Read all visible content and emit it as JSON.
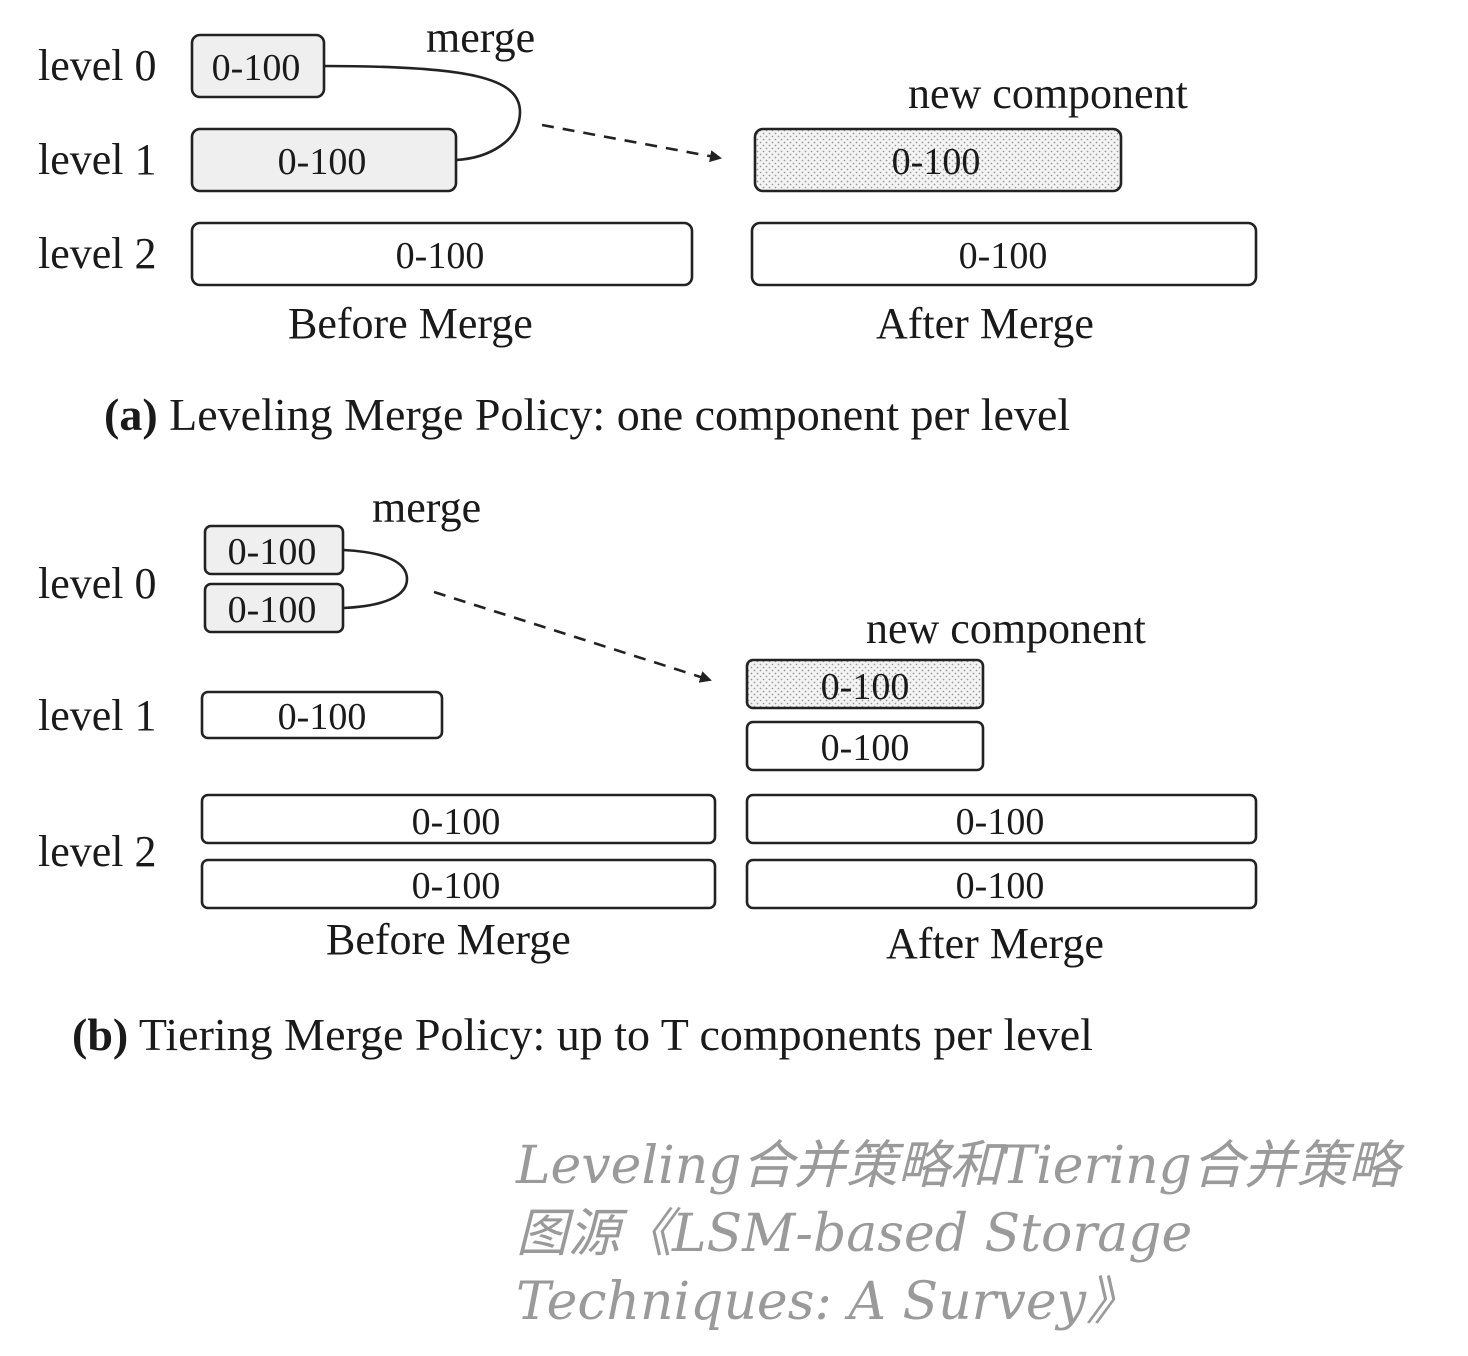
{
  "panel_a": {
    "level_labels": [
      "level 0",
      "level 1",
      "level 2"
    ],
    "merge_label": "merge",
    "new_component_label": "new component",
    "before": {
      "level0": "0-100",
      "level1": "0-100",
      "level2": "0-100",
      "label": "Before Merge"
    },
    "after": {
      "new_component": "0-100",
      "level2": "0-100",
      "label": "After Merge"
    },
    "caption_prefix": "(a)",
    "caption_text": " Leveling Merge Policy: one component per level"
  },
  "panel_b": {
    "level_labels": [
      "level 0",
      "level 1",
      "level 2"
    ],
    "merge_label": "merge",
    "new_component_label": "new component",
    "before": {
      "level0": [
        "0-100",
        "0-100"
      ],
      "level1": "0-100",
      "level2": [
        "0-100",
        "0-100"
      ],
      "label": "Before Merge"
    },
    "after": {
      "new_component": "0-100",
      "level1": "0-100",
      "level2": [
        "0-100",
        "0-100"
      ],
      "label": "After Merge"
    },
    "caption_prefix": "(b)",
    "caption_text": " Tiering Merge Policy: up to T components per level"
  },
  "note": {
    "line1": "Leveling合并策略和Tiering合并策略",
    "line2": "图源《LSM-based Storage",
    "line3": "Techniques: A Survey》"
  },
  "colors": {
    "merging_box_fill": "#efefef",
    "new_component_fill": "dotted",
    "note_text": "#9a9a9a"
  }
}
